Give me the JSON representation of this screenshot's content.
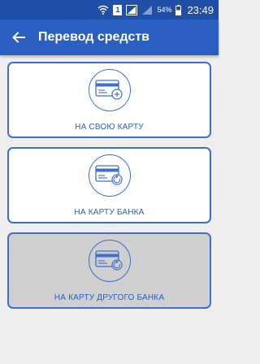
{
  "status_bar": {
    "sim_label": "1",
    "battery_percent": "54%",
    "time": "23:49"
  },
  "app_bar": {
    "title": "Перевод средств"
  },
  "options": [
    {
      "label": "НА СВОЮ КАРТУ",
      "icon": "card-plus-icon",
      "enabled": true
    },
    {
      "label": "НА КАРТУ БАНКА",
      "icon": "card-refresh-icon",
      "enabled": true
    },
    {
      "label": "НА КАРТУ ДРУГОГО БАНКА",
      "icon": "card-refresh-icon",
      "enabled": false
    }
  ],
  "colors": {
    "status_bar": "#1f4fa8",
    "app_bar": "#2b5fc2",
    "accent": "#3e6fd0",
    "background": "#eeeeee",
    "disabled_card": "#cfcfcf"
  }
}
